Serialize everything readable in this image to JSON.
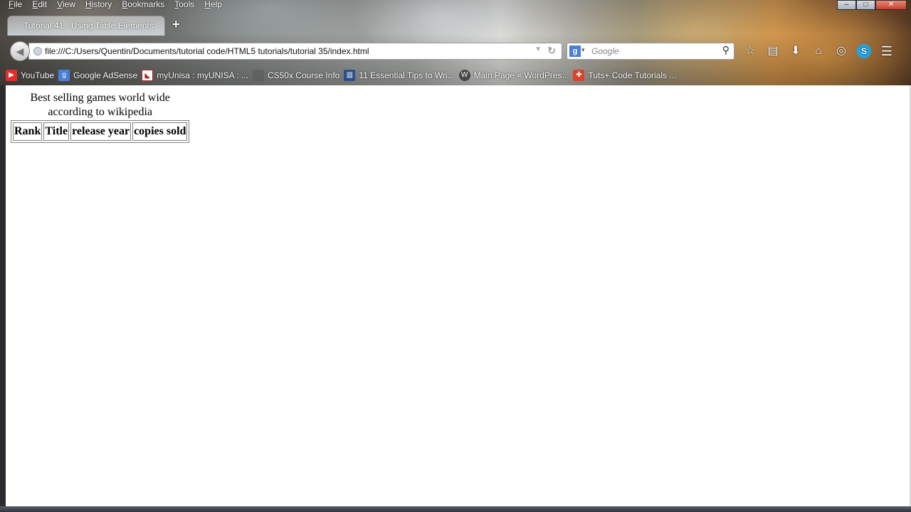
{
  "menu": [
    "File",
    "Edit",
    "View",
    "History",
    "Bookmarks",
    "Tools",
    "Help"
  ],
  "window_controls": {
    "minimize": "–",
    "maximize": "□",
    "close": "✕"
  },
  "tab": {
    "title": "Tutorial 41 - Using Table Elements"
  },
  "url": "file:///C:/Users/Quentin/Documents/tutorial code/HTML5 tutorials/tutorial 35/index.html",
  "search": {
    "engine": "g",
    "placeholder": "Google"
  },
  "bookmarks": [
    {
      "label": "YouTube",
      "icon": "youtube-icon",
      "color": "#e52d27"
    },
    {
      "label": "Google AdSense",
      "icon": "google-icon",
      "color": "#4a7fd6"
    },
    {
      "label": "myUnisa : myUNISA : ...",
      "icon": "unisa-icon",
      "color": "#b22222"
    },
    {
      "label": "CS50x Course Info",
      "icon": "cs50-icon",
      "color": "#555555"
    },
    {
      "label": "11 Essential Tips to Wri...",
      "icon": "site-icon",
      "color": "#2a4f8a"
    },
    {
      "label": "Main Page « WordPres...",
      "icon": "wordpress-icon",
      "color": "#464646"
    },
    {
      "label": "Tuts+ Code Tutorials ...",
      "icon": "tuts-icon",
      "color": "#d9442b"
    }
  ],
  "page": {
    "caption": "Best selling games world wide according to wikipedia",
    "headers": [
      "Rank",
      "Title",
      "release year",
      "copies sold"
    ]
  }
}
